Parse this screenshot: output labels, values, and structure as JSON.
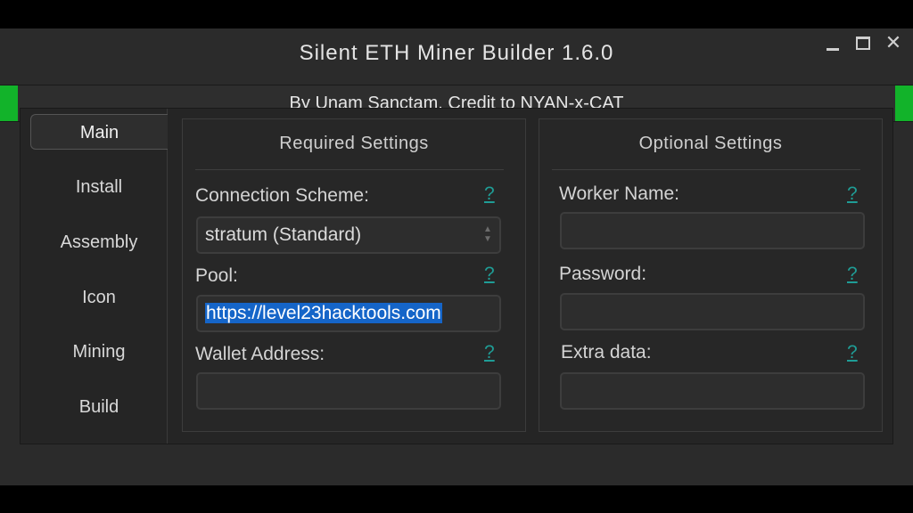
{
  "window": {
    "title": "Silent ETH Miner Builder 1.6.0",
    "banner": "By Unam Sanctam, Credit to NYAN-x-CAT",
    "controls": {
      "minimize_icon": "minimize-icon",
      "maximize_icon": "maximize-icon",
      "close_glyph": "✕"
    }
  },
  "nav": {
    "items": [
      {
        "label": "Main",
        "active": true
      },
      {
        "label": "Install",
        "active": false
      },
      {
        "label": "Assembly",
        "active": false
      },
      {
        "label": "Icon",
        "active": false
      },
      {
        "label": "Mining",
        "active": false
      },
      {
        "label": "Build",
        "active": false
      }
    ]
  },
  "required": {
    "title": "Required Settings",
    "connection_scheme": {
      "label": "Connection Scheme:",
      "help": "?",
      "value": "stratum (Standard)"
    },
    "pool": {
      "label": "Pool:",
      "help": "?",
      "value": "https://level23hacktools.com"
    },
    "wallet": {
      "label": "Wallet Address:",
      "help": "?",
      "value": ""
    }
  },
  "optional": {
    "title": "Optional Settings",
    "worker_name": {
      "label": "Worker Name:",
      "help": "?",
      "value": ""
    },
    "password": {
      "label": "Password:",
      "help": "?",
      "value": ""
    },
    "extra_data": {
      "label": "Extra data:",
      "help": "?",
      "value": ""
    }
  },
  "colors": {
    "accent_green": "#12b32a",
    "help_link": "#1f9d96",
    "selection": "#1565c8",
    "background": "#2b2b2b"
  }
}
